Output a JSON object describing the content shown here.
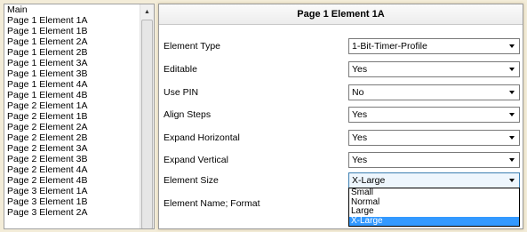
{
  "element_list": {
    "items": [
      "Main",
      "Page 1 Element 1A",
      "Page 1 Element 1B",
      "Page 1 Element 2A",
      "Page 1 Element 2B",
      "Page 1 Element 3A",
      "Page 1 Element 3B",
      "Page 1 Element 4A",
      "Page 1 Element 4B",
      "Page 2 Element 1A",
      "Page 2 Element 1B",
      "Page 2 Element 2A",
      "Page 2 Element 2B",
      "Page 2 Element 3A",
      "Page 2 Element 3B",
      "Page 2 Element 4A",
      "Page 2 Element 4B",
      "Page 3 Element 1A",
      "Page 3 Element 1B",
      "Page 3 Element 2A"
    ],
    "scroll_up_icon": "triangle-up-icon"
  },
  "properties": {
    "header": "Page 1 Element 1A",
    "rows": [
      {
        "label": "Element Type",
        "value": "1-Bit-Timer-Profile"
      },
      {
        "label": "Editable",
        "value": "Yes"
      },
      {
        "label": "Use PIN",
        "value": "No"
      },
      {
        "label": "Align Steps",
        "value": "Yes"
      },
      {
        "label": "Expand Horizontal",
        "value": "Yes"
      },
      {
        "label": "Expand Vertical",
        "value": "Yes"
      },
      {
        "label": "Element Size",
        "value": "X-Large"
      }
    ],
    "name_format_label": "Element Name; Format",
    "size_dropdown": {
      "options": [
        "Small",
        "Normal",
        "Large",
        "X-Large"
      ],
      "selected": "X-Large"
    }
  },
  "colors": {
    "background": "#f3ecd8",
    "selection": "#3399ff",
    "active_border": "#3c7fb1"
  }
}
